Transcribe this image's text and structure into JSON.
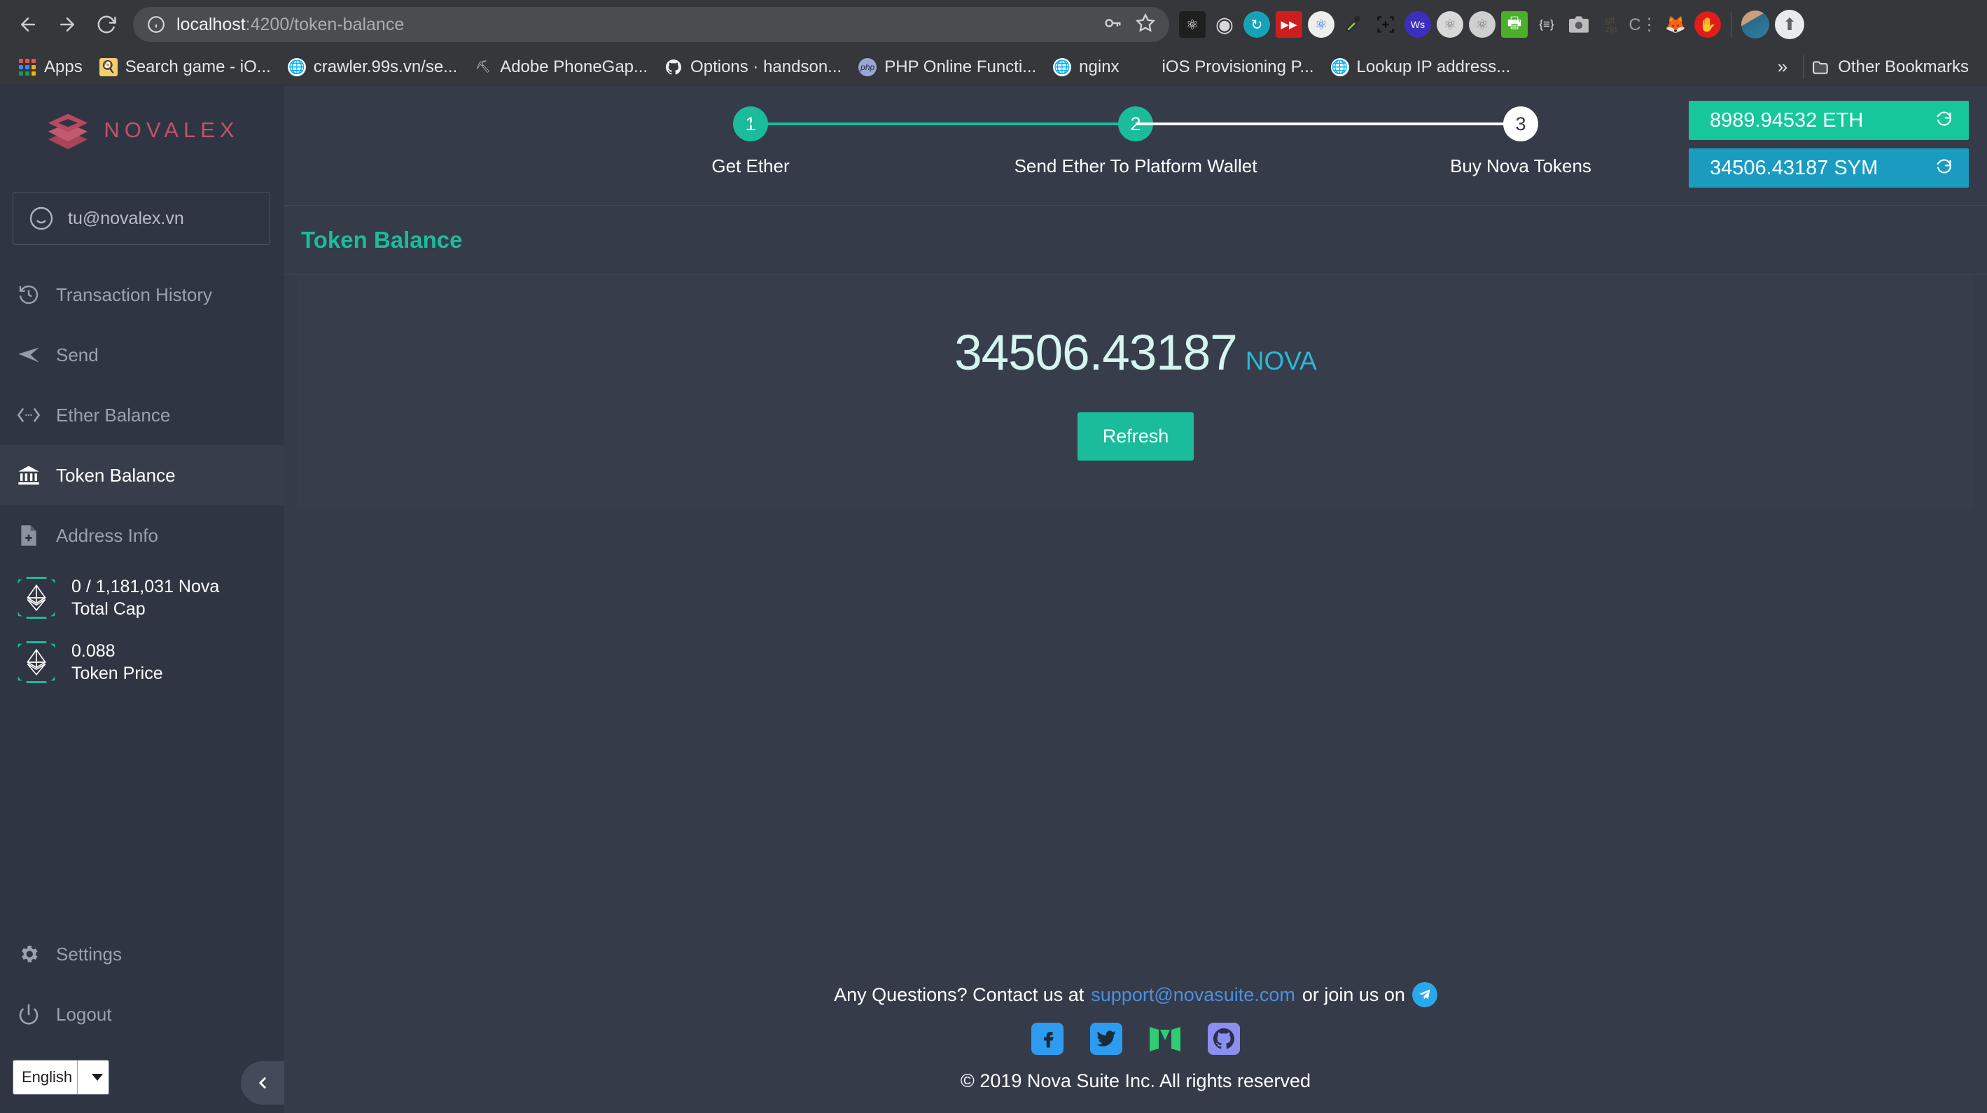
{
  "browser": {
    "back_label": "Back",
    "forward_label": "Forward",
    "reload_label": "Reload",
    "url_host": "localhost",
    "url_path": ":4200/token-balance",
    "info_icon": "info-circle-icon",
    "key_icon": "key-icon",
    "star_icon": "star-icon",
    "extensions": [
      {
        "name": "react-devtools-icon",
        "glyph": "⚛",
        "bg": "#1f1f1f",
        "color": "#ffffff"
      },
      {
        "name": "target-icon",
        "glyph": "◉",
        "bg": "transparent",
        "color": "#d8d8d8"
      },
      {
        "name": "emmet-icon",
        "glyph": "↻",
        "bg": "#17a2b8",
        "color": "#ffffff"
      },
      {
        "name": "video-speed-icon",
        "glyph": "▶▶",
        "bg": "#cc1e1e",
        "color": "#ffffff"
      },
      {
        "name": "atom-colorful-icon",
        "glyph": "⚛",
        "bg": "#eeeeee",
        "color": "#2f6fd0"
      },
      {
        "name": "eyedropper-icon",
        "glyph": "✐",
        "bg": "transparent",
        "color": "#8fd14f"
      },
      {
        "name": "screen-capture-icon",
        "glyph": "⬚",
        "bg": "transparent",
        "color": "#111111"
      },
      {
        "name": "wappalyzer-icon",
        "glyph": "Ws",
        "bg": "#3b2fbd",
        "color": "#ffffff"
      },
      {
        "name": "react-gray-icon",
        "glyph": "⚛",
        "bg": "#d8d8d8",
        "color": "#555555"
      },
      {
        "name": "react-gray2-icon",
        "glyph": "⚛",
        "bg": "#cfcfcf",
        "color": "#666666"
      },
      {
        "name": "print-friendly-icon",
        "glyph": "⎙",
        "bg": "#4caf2a",
        "color": "#ffffff"
      },
      {
        "name": "json-formatter-icon",
        "glyph": "{≡}",
        "bg": "transparent",
        "color": "#e0e0e0"
      },
      {
        "name": "camera-icon",
        "glyph": "὏7",
        "bg": "transparent",
        "color": "#bdbdbd"
      },
      {
        "name": "gitzip-icon",
        "glyph": "git",
        "bg": "transparent",
        "color": "#5a4a3a"
      },
      {
        "name": "clockify-icon",
        "glyph": "C⋮",
        "bg": "transparent",
        "color": "#9e9e9e"
      },
      {
        "name": "metamask-fox-icon",
        "glyph": "ᾘA",
        "bg": "transparent",
        "color": "#e2761b"
      },
      {
        "name": "adblock-icon",
        "glyph": "✋",
        "bg": "#e21b1b",
        "color": "#ffffff"
      }
    ]
  },
  "bookmarks": {
    "apps_label": "Apps",
    "items": [
      {
        "label": "Search game - iO...",
        "icon": "bookmark-favicon",
        "bg": "#f7c948",
        "glyph": "◔"
      },
      {
        "label": "crawler.99s.vn/se...",
        "icon": "globe-icon",
        "bg": "#ffffff",
        "glyph": "ἱ0"
      },
      {
        "label": "Adobe PhoneGap...",
        "icon": "phonegap-icon",
        "bg": "transparent",
        "glyph": "⛏"
      },
      {
        "label": "Options · handson...",
        "icon": "github-icon",
        "bg": "transparent",
        "glyph": "ὃ1"
      },
      {
        "label": "PHP Online Functi...",
        "icon": "php-icon",
        "bg": "#8892bf",
        "glyph": "php"
      },
      {
        "label": "nginx",
        "icon": "globe-icon",
        "bg": "#ffffff",
        "glyph": "ἱ0"
      },
      {
        "label": "iOS Provisioning P...",
        "icon": "apple-icon",
        "bg": "transparent",
        "glyph": ""
      },
      {
        "label": "Lookup IP address...",
        "icon": "globe-icon",
        "bg": "#ffffff",
        "glyph": "ἱ0"
      }
    ],
    "overflow_label": "»",
    "other_bookmarks_label": "Other Bookmarks",
    "folder_icon": "folder-icon"
  },
  "sidebar": {
    "brand": "NOVALEX",
    "brand_color": "#c1536a",
    "account": {
      "icon": "smiley-face-icon",
      "email": "tu@novalex.vn"
    },
    "nav_items": [
      {
        "label": "Transaction History",
        "icon": "history-clock-icon",
        "active": false
      },
      {
        "label": "Send",
        "icon": "paper-plane-icon",
        "active": false
      },
      {
        "label": "Ether Balance",
        "icon": "code-arrows-icon",
        "active": false
      },
      {
        "label": "Token Balance",
        "icon": "bank-icon",
        "active": true
      },
      {
        "label": "Address Info",
        "icon": "file-plus-icon",
        "active": false
      }
    ],
    "stats": [
      {
        "icon": "ethereum-diamond-icon",
        "value": "0 / 1,181,031 Nova",
        "label": "Total Cap"
      },
      {
        "icon": "ethereum-diamond-icon",
        "value": "0.088",
        "label": "Token Price"
      }
    ],
    "bottom_items": [
      {
        "label": "Settings",
        "icon": "gear-icon"
      },
      {
        "label": "Logout",
        "icon": "power-icon"
      }
    ],
    "language": {
      "selected": "English",
      "options": [
        "English"
      ]
    },
    "collapse_icon": "chevron-left-icon"
  },
  "stepper": {
    "steps": [
      {
        "number": "1",
        "label": "Get Ether",
        "state": "done"
      },
      {
        "number": "2",
        "label": "Send Ether To Platform Wallet",
        "state": "done"
      },
      {
        "number": "3",
        "label": "Buy Nova Tokens",
        "state": "todo"
      }
    ]
  },
  "balances": [
    {
      "value": "8989.94532 ETH",
      "color": "#16c79a",
      "refresh_icon": "refresh-icon"
    },
    {
      "value": "34506.43187 SYM",
      "color": "#1a9cc0",
      "refresh_icon": "refresh-icon"
    }
  ],
  "page": {
    "title": "Token Balance",
    "title_color": "#1abc9c",
    "balance_value": "34506.43187",
    "balance_unit": "NOVA",
    "refresh_label": "Refresh"
  },
  "footer": {
    "contact_prefix": "Any Questions? Contact us at",
    "contact_email": "support@novasuite.com",
    "contact_suffix": "or join us on",
    "telegram_icon": "telegram-icon",
    "socials": [
      {
        "name": "facebook-icon",
        "glyph": "f",
        "bg": "#2d9cf0"
      },
      {
        "name": "twitter-icon",
        "glyph": "ὂ6",
        "bg": "#2d9cf0"
      },
      {
        "name": "medium-icon",
        "glyph": "M",
        "bg": "transparent"
      },
      {
        "name": "github-icon",
        "glyph": "Ⓘ",
        "bg": "#8b8ff0"
      }
    ],
    "copyright": "© 2019 Nova Suite Inc. All rights reserved"
  }
}
